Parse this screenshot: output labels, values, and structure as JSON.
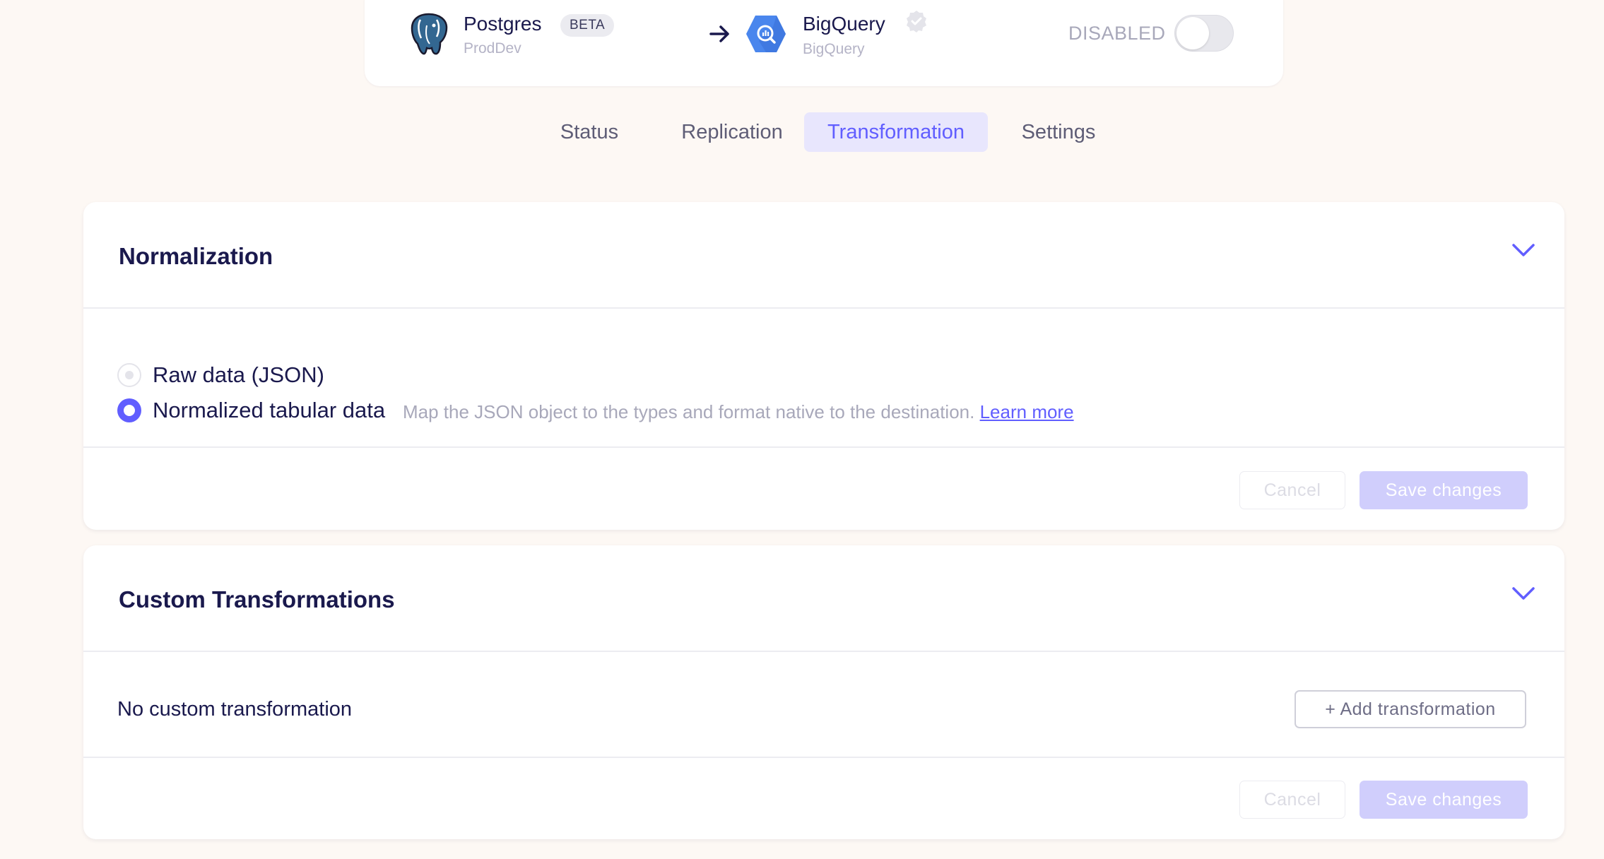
{
  "connection": {
    "source_name": "Postgres",
    "source_badge": "BETA",
    "source_sub": "ProdDev",
    "destination_name": "BigQuery",
    "destination_sub": "BigQuery",
    "status_label": "DISABLED",
    "enabled": false
  },
  "tabs": [
    {
      "label": "Status",
      "active": false
    },
    {
      "label": "Replication",
      "active": false
    },
    {
      "label": "Transformation",
      "active": true
    },
    {
      "label": "Settings",
      "active": false
    }
  ],
  "normalization": {
    "title": "Normalization",
    "options": [
      {
        "label": "Raw data (JSON)",
        "selected": false
      },
      {
        "label": "Normalized tabular data",
        "selected": true,
        "description": "Map the JSON object to the types and format native to the destination.",
        "link": "Learn more"
      }
    ],
    "cancel_label": "Cancel",
    "save_label": "Save changes"
  },
  "custom_transformations": {
    "title": "Custom Transformations",
    "empty_text": "No custom transformation",
    "add_label": "+ Add transformation",
    "cancel_label": "Cancel",
    "save_label": "Save changes"
  },
  "colors": {
    "accent": "#615eff",
    "accent_light": "#e8e6fd",
    "background": "#fdf8f4",
    "text": "#1a194d"
  },
  "icons": {
    "source": "postgres-elephant-icon",
    "arrow": "arrow-right-icon",
    "destination": "bigquery-hexagon-icon",
    "verified": "verified-badge-icon",
    "collapse": "chevron-down-icon"
  }
}
